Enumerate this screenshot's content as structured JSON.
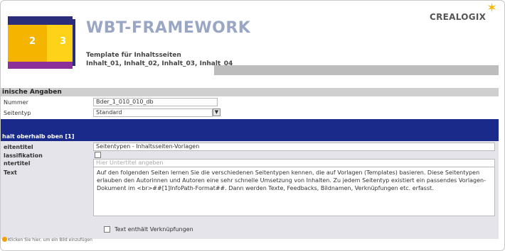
{
  "header": {
    "title": "WBT-FRAMEWORK",
    "subtitle_line1": "Template für Inhaltsseiten",
    "subtitle_line2": "Inhalt_01, Inhalt_02, Inhalt_03, Inhalt_04",
    "logo_text": "CREALOGIX",
    "thumbnail_numbers": [
      "2",
      "3"
    ]
  },
  "basic_section": {
    "header": "inische Angaben",
    "fields": [
      {
        "label": "Nummer",
        "value": "Bder_1_010_010_db"
      },
      {
        "label": "Seitentyp",
        "value": "Standard"
      }
    ]
  },
  "content_section": {
    "header": "halt oberhalb oben [1]",
    "fields": [
      {
        "label": "eitentitel",
        "value": "Seitentypen - Inhaltsseiten-Vorlagen"
      },
      {
        "label": "lassifikation",
        "value": ""
      },
      {
        "label": "ntertitel",
        "placeholder": "Hier Untertitel angeben"
      },
      {
        "label": "Text",
        "value": "Auf den folgenden Seiten lernen Sie die verschiedenen Seitentypen kennen, die auf Vorlagen (Templates) basieren. Diese Seitentypen erlauben den Autorinnen und Autoren eine sehr schnelle Umsetzung von Inhalten. Zu jedem Seitentyp existiert ein passendes Vorlagen-Dokument im <br>##[1]InfoPath-Format##. Dann werden Texte, Feedbacks, Bildnamen, Verknüpfungen etc. erfasst."
      }
    ],
    "checkbox_label": "Text enthält Verknüpfungen"
  },
  "footer": {
    "note": "Klicken Sie hier, um ein Bild einzufügen"
  },
  "colors": {
    "accent_blue": "#1a2a8a",
    "thumb_orange": "#f5b400",
    "thumb_yellow": "#ffd21a",
    "thumb_purple": "#8b2f9a",
    "logo_star": "#f7b600"
  }
}
